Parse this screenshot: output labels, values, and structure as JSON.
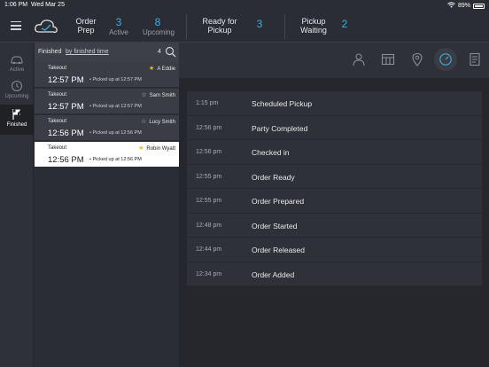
{
  "status_bar": {
    "time": "1:06 PM",
    "date": "Wed Mar 25",
    "battery": "89%"
  },
  "header": {
    "order_prep": {
      "label_line1": "Order",
      "label_line2": "Prep",
      "active_count": "3",
      "active_label": "Active",
      "upcoming_count": "8",
      "upcoming_label": "Upcoming"
    },
    "ready": {
      "label_line1": "Ready for",
      "label_line2": "Pickup",
      "count": "3"
    },
    "pickup_waiting": {
      "label_line1": "Pickup",
      "label_line2": "Waiting",
      "count": "2"
    }
  },
  "rail": [
    {
      "label": "Active",
      "icon": "car-icon"
    },
    {
      "label": "Upcoming",
      "icon": "clock-icon"
    },
    {
      "label": "Finished",
      "icon": "finish-flag-icon"
    }
  ],
  "list": {
    "title": "Finished",
    "sort_label": "by finished time",
    "count": "4",
    "orders": [
      {
        "type": "Takeout",
        "time": "12:57 PM",
        "pickup": "Picked up at 12:57 PM",
        "name": "A Eddie",
        "starred": true
      },
      {
        "type": "Takeout",
        "time": "12:57 PM",
        "pickup": "Picked up at 12:57 PM",
        "name": "Sam Smith",
        "starred": false
      },
      {
        "type": "Takeout",
        "time": "12:56 PM",
        "pickup": "Picked up at 12:56 PM",
        "name": "Lucy Smith",
        "starred": false
      },
      {
        "type": "Takeout",
        "time": "12:56 PM",
        "pickup": "Picked up at 12:56 PM",
        "name": "Robin Wyatt",
        "starred": true
      }
    ]
  },
  "detail": {
    "tabs": [
      "person-icon",
      "table-icon",
      "location-pin-icon",
      "clock-icon",
      "receipt-icon"
    ],
    "events": [
      {
        "time": "1:15 pm",
        "name": "Scheduled Pickup"
      },
      {
        "time": "12:56 pm",
        "name": "Party Completed"
      },
      {
        "time": "12:56 pm",
        "name": "Checked in"
      },
      {
        "time": "12:55 pm",
        "name": "Order Ready"
      },
      {
        "time": "12:55 pm",
        "name": "Order Prepared"
      },
      {
        "time": "12:48 pm",
        "name": "Order Started"
      },
      {
        "time": "12:44 pm",
        "name": "Order Released"
      },
      {
        "time": "12:34 pm",
        "name": "Order Added"
      }
    ]
  },
  "colors": {
    "accent": "#3ab0e8",
    "star": "#f2b632"
  }
}
